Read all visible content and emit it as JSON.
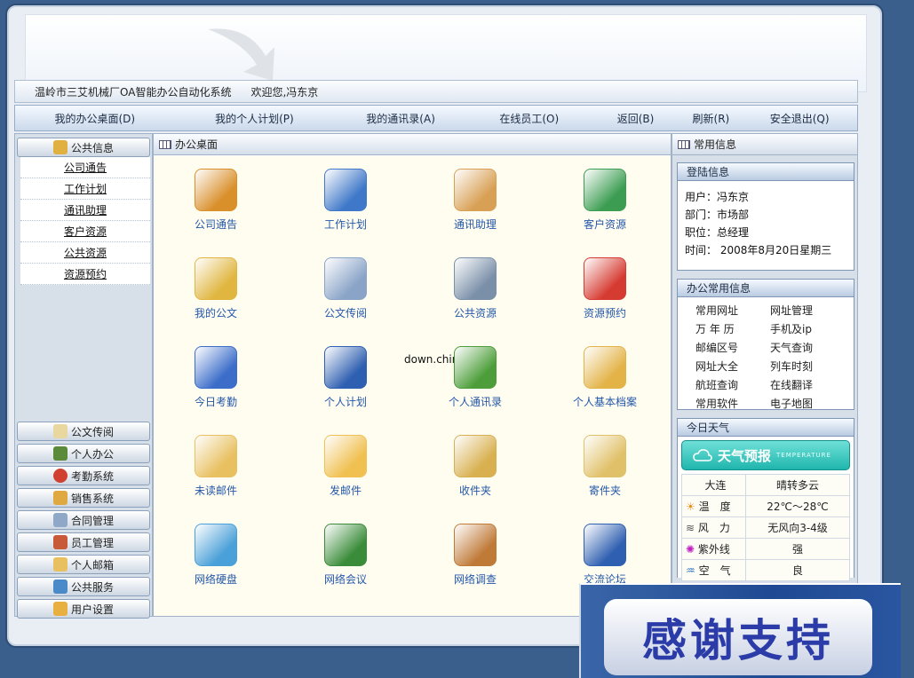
{
  "titlebar": {
    "system_name": "温岭市三艾机械厂OA智能办公自动化系统",
    "welcome": "欢迎您,冯东京"
  },
  "menu": [
    "我的办公桌面(D)",
    "我的个人计划(P)",
    "我的通讯录(A)",
    "在线员工(O)",
    "返回(B)",
    "刷新(R)",
    "安全退出(Q)"
  ],
  "left": {
    "top_section": "公共信息",
    "sub_items": [
      "公司通告",
      "工作计划",
      "通讯助理",
      "客户资源",
      "公共资源",
      "资源预约"
    ],
    "sections": [
      "公文传阅",
      "个人办公",
      "考勤系统",
      "销售系统",
      "合同管理",
      "员工管理",
      "个人邮箱",
      "公共服务",
      "用户设置"
    ]
  },
  "center": {
    "title": "办公桌面",
    "watermark": "down.chinaz.com",
    "apps": [
      "公司通告",
      "工作计划",
      "通讯助理",
      "客户资源",
      "我的公文",
      "公文传阅",
      "公共资源",
      "资源预约",
      "今日考勤",
      "个人计划",
      "个人通讯录",
      "个人基本档案",
      "未读邮件",
      "发邮件",
      "收件夹",
      "寄件夹",
      "网络硬盘",
      "网络会议",
      "网络调查",
      "交流论坛"
    ],
    "icon_colors": [
      "#d98f2a",
      "#3f78c8",
      "#d8a055",
      "#3c9d52",
      "#e0b640",
      "#8aa4c8",
      "#7a8fa8",
      "#d63b32",
      "#3b6dc9",
      "#2e5fb0",
      "#4d9e3a",
      "#e3b348",
      "#e8c060",
      "#f0c050",
      "#d8b050",
      "#e0c068",
      "#4aa0d8",
      "#3b8c3a",
      "#c07a38",
      "#2e5fb0"
    ]
  },
  "right": {
    "title": "常用信息",
    "login": {
      "title": "登陆信息",
      "lines": [
        "用户：冯东京",
        "部门：市场部",
        "职位：总经理",
        "时间： 2008年8月20日星期三"
      ]
    },
    "office": {
      "title": "办公常用信息",
      "links": [
        "常用网址",
        "网址管理",
        "万 年 历",
        "手机及ip",
        "邮编区号",
        "天气查询",
        "网址大全",
        "列车时刻",
        "航班查询",
        "在线翻译",
        "常用软件",
        "电子地图"
      ]
    },
    "weather": {
      "title": "今日天气",
      "banner": "天气预报",
      "banner_sub": "TEMPERATURE",
      "city": "大连",
      "condition": "晴转多云",
      "rows": [
        {
          "k": "温　度",
          "v": "22℃～28℃"
        },
        {
          "k": "风　力",
          "v": "无风向3-4级"
        },
        {
          "k": "紫外线",
          "v": "强"
        },
        {
          "k": "空　气",
          "v": "良"
        }
      ]
    }
  },
  "overlay": {
    "text": "感谢支持"
  }
}
